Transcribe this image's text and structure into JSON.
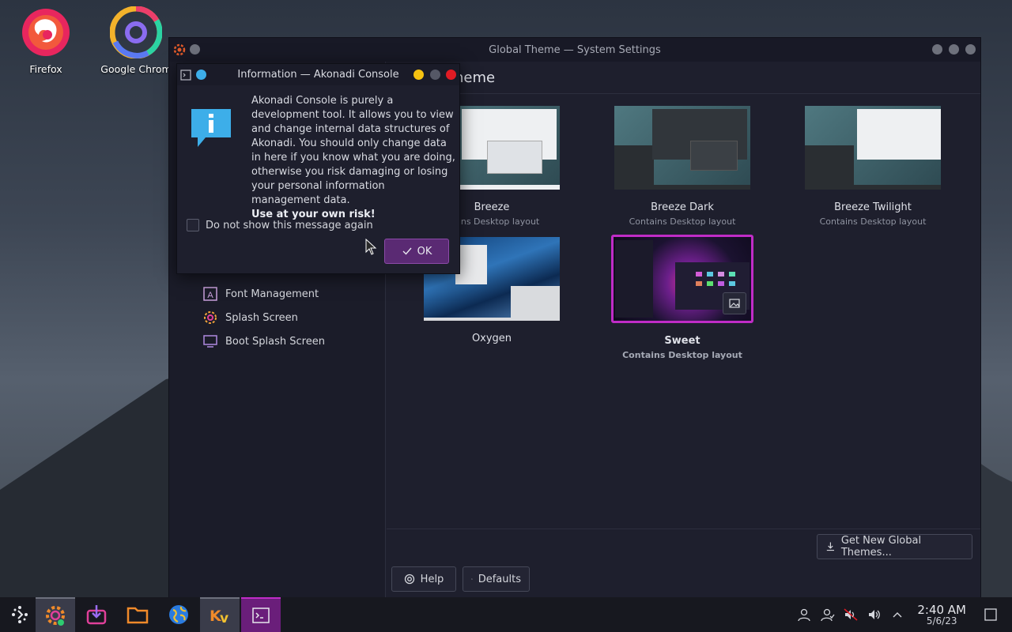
{
  "desktop": {
    "icons": [
      {
        "label": "Firefox",
        "icon": "firefox-icon"
      },
      {
        "label": "Google Chrom",
        "icon": "chrome-icon"
      }
    ]
  },
  "main_window": {
    "title": "Global Theme — System Settings",
    "page_title": "heme",
    "sidebar_items": [
      {
        "label": "Font Management",
        "icon": "font-management-icon"
      },
      {
        "label": "Splash Screen",
        "icon": "splash-screen-icon"
      },
      {
        "label": "Boot Splash Screen",
        "icon": "boot-splash-icon"
      }
    ],
    "themes": [
      {
        "name": "Breeze",
        "subtitle": "ntains Desktop layout"
      },
      {
        "name": "Breeze Dark",
        "subtitle": "Contains Desktop layout"
      },
      {
        "name": "Breeze Twilight",
        "subtitle": "Contains Desktop layout"
      },
      {
        "name": "Oxygen",
        "subtitle": ""
      },
      {
        "name": "Sweet",
        "subtitle": "Contains Desktop layout",
        "selected": true
      }
    ],
    "get_new_label": "Get New Global Themes...",
    "help_label": "Help",
    "defaults_label": "Defaults"
  },
  "dialog": {
    "title": "Information — Akonadi Console",
    "message": "Akonadi Console is purely a development tool. It allows you to view and change internal data structures of Akonadi. You should only change data in here if you know what you are doing, otherwise you risk damaging or losing your personal information management data.",
    "warning": "Use at your own risk!",
    "checkbox_label": "Do not show this message again",
    "ok_label": "OK",
    "colors": {
      "minimize": "#f5c211",
      "maximize": "#555866",
      "close": "#e01b24",
      "info": "#3daee9"
    }
  },
  "taskbar": {
    "apps": [
      "app-launcher-icon",
      "system-settings-icon",
      "discover-icon",
      "files-icon",
      "browser-icon",
      "kvantum-icon",
      "terminal-icon"
    ],
    "tray": [
      "user-icon",
      "users-icon",
      "muted-audio-icon",
      "volume-icon",
      "chevron-up-icon"
    ],
    "time": "2:40 AM",
    "date": "5/6/23"
  },
  "colors": {
    "accent": "#c02cc7",
    "ok_button": "#5a2a73"
  }
}
